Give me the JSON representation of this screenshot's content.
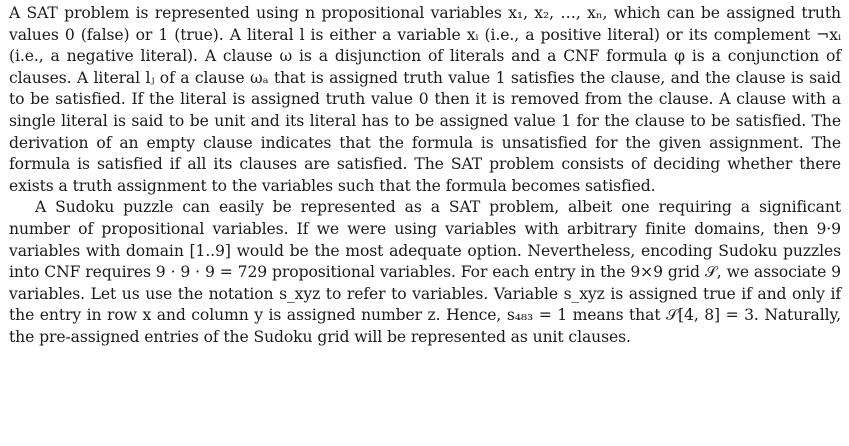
{
  "document": {
    "paragraphs": [
      {
        "text": "A SAT problem is represented using n propositional variables x₁, x₂, …, xₙ, which can be assigned truth values 0 (false) or 1 (true). A literal l is either a variable xᵢ (i.e., a positive literal) or its complement ¬xᵢ (i.e., a negative literal). A clause ω is a disjunction of literals and a CNF formula φ is a conjunction of clauses. A literal lⱼ of a clause ωₐ that is assigned truth value 1 satisfies the clause, and the clause is said to be satisfied. If the literal is assigned truth value 0 then it is removed from the clause. A clause with a single literal is said to be unit and its literal has to be assigned value 1 for the clause to be satisfied. The derivation of an empty clause indicates that the formula is unsatisfied for the given assignment. The formula is satisfied if all its clauses are satisfied. The SAT problem consists of deciding whether there exists a truth assignment to the variables such that the formula becomes satisfied."
      },
      {
        "text": "A Sudoku puzzle can easily be represented as a SAT problem, albeit one requiring a significant number of propositional variables. If we were using variables with arbitrary finite domains, then 9·9 variables with domain [1..9] would be the most adequate option. Nevertheless, encoding Sudoku puzzles into CNF requires 9 · 9 · 9 = 729 propositional variables. For each entry in the 9×9 grid 𝒮, we associate 9 variables. Let us use the notation s_xyz to refer to variables. Variable s_xyz is assigned true if and only if the entry in row x and column y is assigned number z. Hence, s₄₈₃ = 1 means that 𝒮[4, 8] = 3. Naturally, the pre-assigned entries of the Sudoku grid will be represented as unit clauses."
      }
    ]
  }
}
